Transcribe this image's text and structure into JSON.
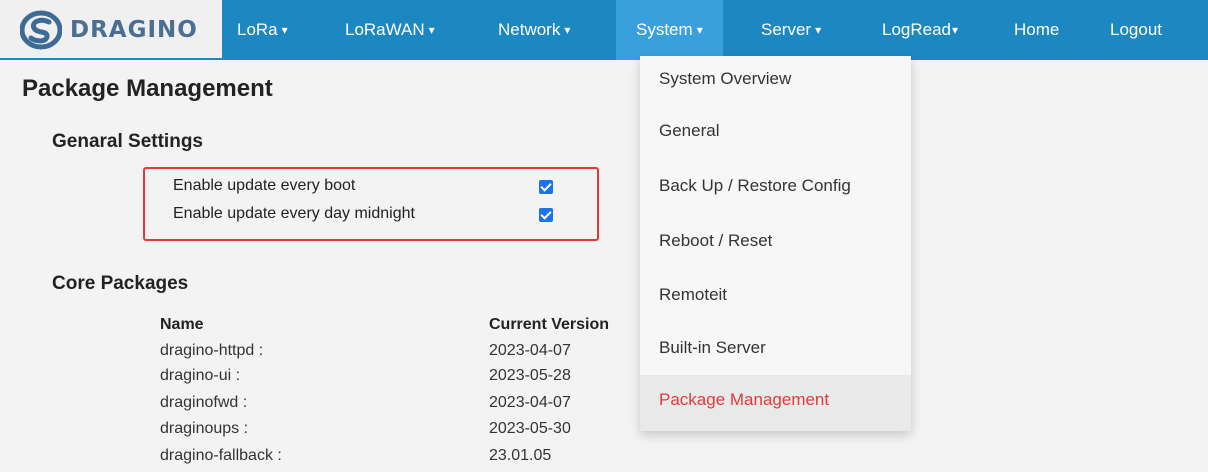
{
  "brand": {
    "name": "DRAGINO"
  },
  "nav": {
    "items": [
      {
        "label": "LoRa",
        "caret": "▾"
      },
      {
        "label": "LoRaWAN",
        "caret": "▾"
      },
      {
        "label": "Network",
        "caret": "▾"
      },
      {
        "label": "System",
        "caret": "▾"
      },
      {
        "label": "Server",
        "caret": "▾"
      },
      {
        "label": "LogRead",
        "caret": "▾"
      },
      {
        "label": "Home"
      },
      {
        "label": "Logout"
      }
    ],
    "active": "System"
  },
  "page": {
    "title": "Package Management"
  },
  "general": {
    "title": "Genaral Settings",
    "options": [
      {
        "label": "Enable update every boot",
        "checked": true
      },
      {
        "label": "Enable update every day midnight",
        "checked": true
      }
    ]
  },
  "core": {
    "title": "Core Packages",
    "headers": {
      "name": "Name",
      "version": "Current Version"
    },
    "rows": [
      {
        "name": "dragino-httpd :",
        "version": "2023-04-07"
      },
      {
        "name": "dragino-ui :",
        "version": "2023-05-28"
      },
      {
        "name": "draginofwd :",
        "version": "2023-04-07"
      },
      {
        "name": "draginoups :",
        "version": "2023-05-30"
      },
      {
        "name": "dragino-fallback :",
        "version": "23.01.05"
      }
    ]
  },
  "system_menu": {
    "items": [
      {
        "label": "System Overview"
      },
      {
        "label": "General"
      },
      {
        "label": "Back Up / Restore Config"
      },
      {
        "label": "Reboot / Reset"
      },
      {
        "label": "Remoteit"
      },
      {
        "label": "Built-in Server"
      },
      {
        "label": "Package Management"
      }
    ],
    "selected": "Package Management"
  },
  "colors": {
    "nav_bg": "#1d87c2",
    "nav_active": "#3aa0dd",
    "highlight": "#e23a3a",
    "checkbox": "#1a73e8"
  }
}
